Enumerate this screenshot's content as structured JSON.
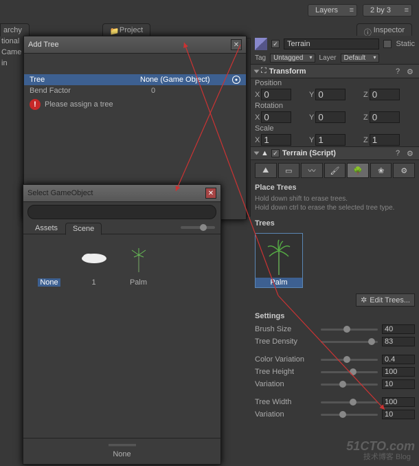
{
  "topbar": {
    "layers": "Layers",
    "layout": "2 by 3"
  },
  "tabs": {
    "hierarchy": "archy",
    "project": "Project",
    "inspector": "Inspector"
  },
  "hierarchy": {
    "items": [
      "tional",
      "Came",
      "in"
    ]
  },
  "addTree": {
    "title": "Add Tree",
    "fields": {
      "tree_label": "Tree",
      "tree_value": "None (Game Object)",
      "bend_label": "Bend Factor",
      "bend_value": "0"
    },
    "error": "Please assign a tree"
  },
  "selectGO": {
    "title": "Select GameObject",
    "search_placeholder": "",
    "tabs": {
      "assets": "Assets",
      "scene": "Scene"
    },
    "items": [
      {
        "name": "None",
        "icon": "none"
      },
      {
        "name": "1",
        "icon": "cloud"
      },
      {
        "name": "Palm",
        "icon": "palm"
      }
    ],
    "footer": "None"
  },
  "inspector": {
    "go_name": "Terrain",
    "static_label": "Static",
    "tag_label": "Tag",
    "tag_value": "Untagged",
    "layer_label": "Layer",
    "layer_value": "Default",
    "transform": {
      "title": "Transform",
      "position_label": "Position",
      "position": {
        "x": "0",
        "y": "0",
        "z": "0"
      },
      "rotation_label": "Rotation",
      "rotation": {
        "x": "0",
        "y": "0",
        "z": "0"
      },
      "scale_label": "Scale",
      "scale": {
        "x": "1",
        "y": "1",
        "z": "1"
      }
    },
    "terrain": {
      "title": "Terrain (Script)",
      "place_trees_title": "Place Trees",
      "hint1": "Hold down shift to erase trees.",
      "hint2": "Hold down ctrl to erase the selected tree type.",
      "trees_label": "Trees",
      "tree_thumb_label": "Palm",
      "edit_trees_label": "Edit Trees...",
      "settings_label": "Settings",
      "sliders": {
        "brush_size": {
          "label": "Brush Size",
          "value": "40",
          "pct": 40
        },
        "tree_density": {
          "label": "Tree Density",
          "value": "83",
          "pct": 83
        },
        "color_variation": {
          "label": "Color Variation",
          "value": "0.4",
          "pct": 40
        },
        "tree_height": {
          "label": "Tree Height",
          "value": "100",
          "pct": 50
        },
        "variation1": {
          "label": "Variation",
          "value": "10",
          "pct": 33
        },
        "tree_width": {
          "label": "Tree Width",
          "value": "100",
          "pct": 50
        },
        "variation2": {
          "label": "Variation",
          "value": "10",
          "pct": 33
        }
      }
    }
  },
  "watermark": {
    "main": "51CTO.com",
    "sub": "技术博客    Blog"
  }
}
